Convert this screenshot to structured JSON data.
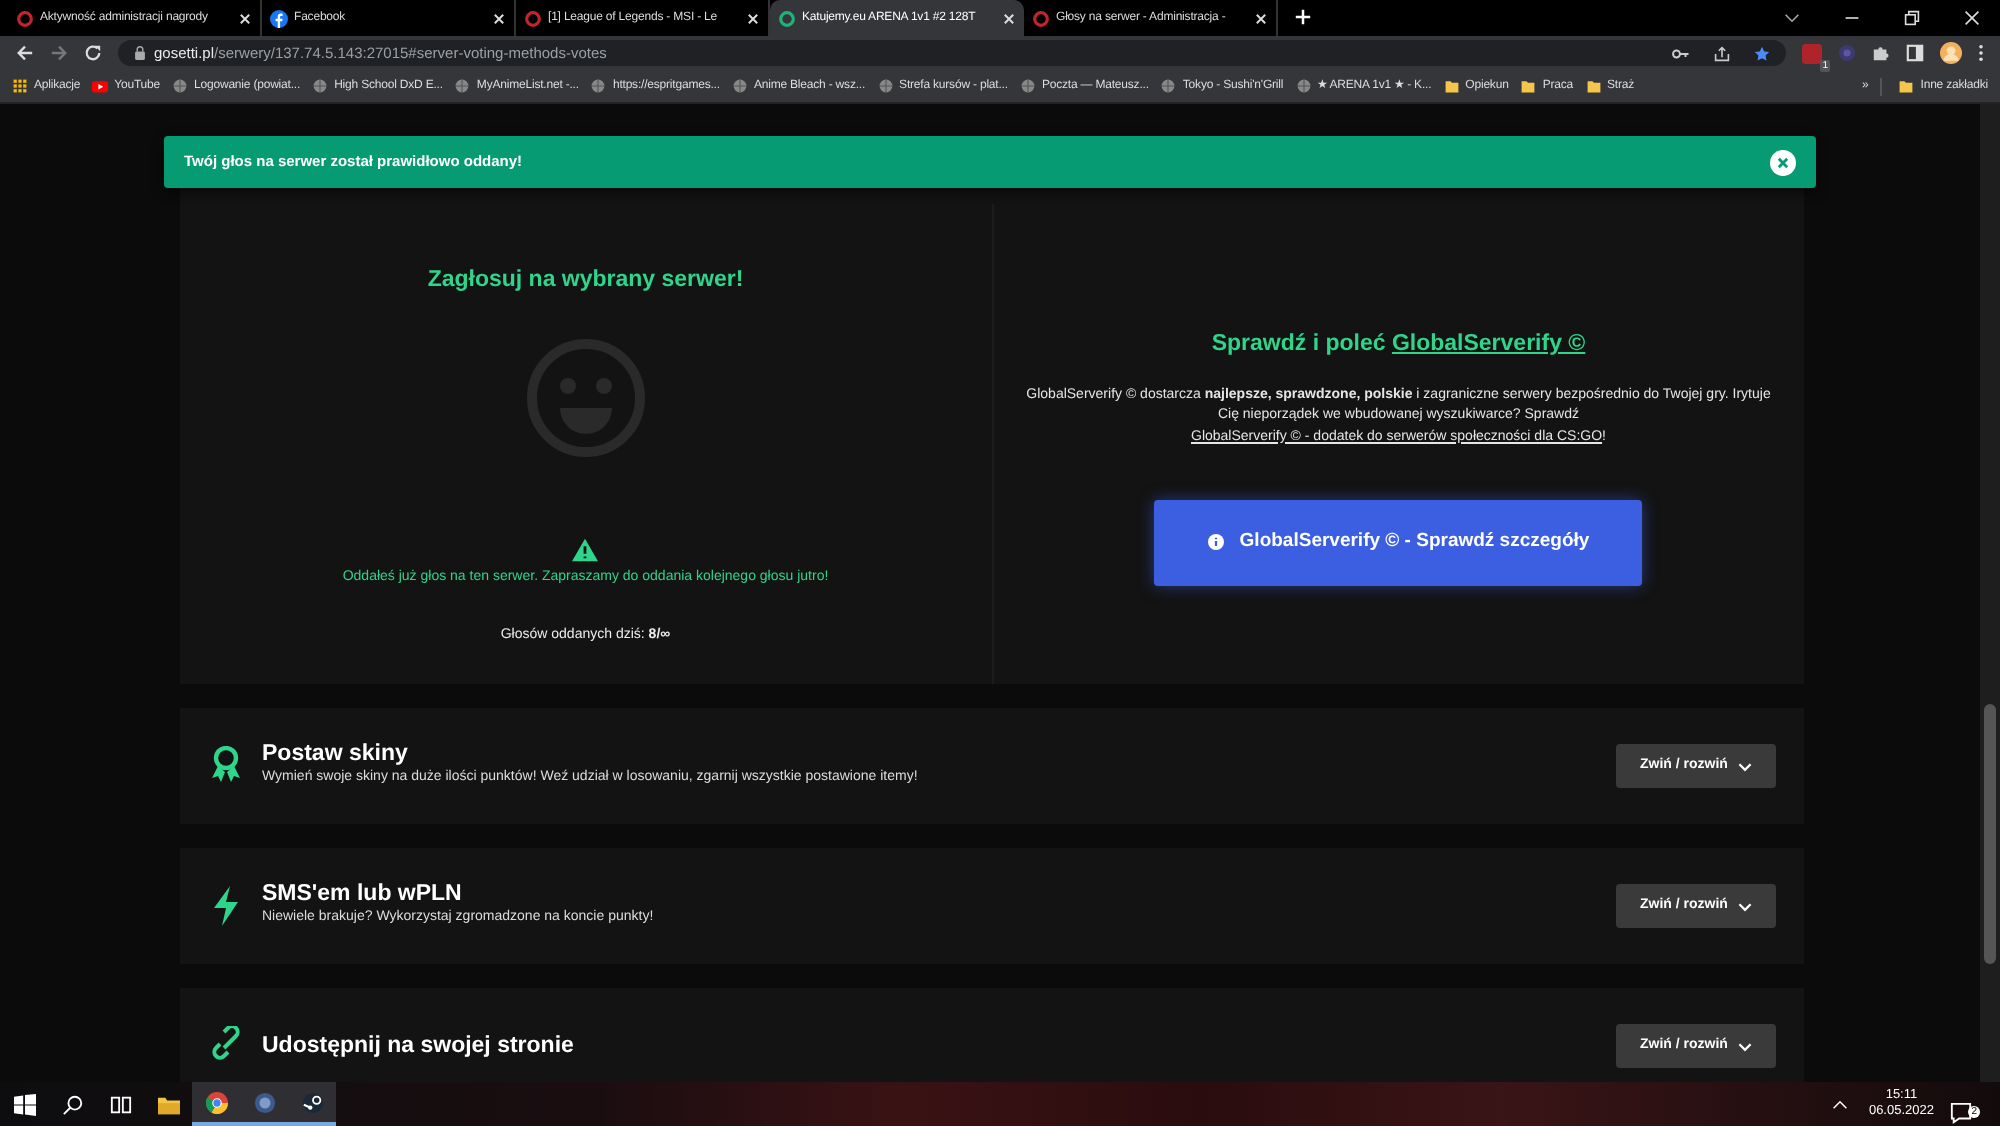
{
  "browser": {
    "tabs": [
      {
        "title": "Aktywność administracji nagrody",
        "kind": "ring",
        "selected": false
      },
      {
        "title": "Facebook",
        "kind": "social",
        "selected": false
      },
      {
        "title": "[1] League of Legends - MSI - Le",
        "kind": "ring",
        "selected": false
      },
      {
        "title": "Katujemy.eu ARENA 1v1 #2 128T",
        "kind": "ring",
        "selected": true
      },
      {
        "title": "Głosy na serwer - Administracja -",
        "kind": "ring",
        "selected": false
      }
    ],
    "address": {
      "domain": "gosetti.pl",
      "path": "/serwery/137.74.5.143:27015#server-voting-methods-votes"
    },
    "extension_badge": "1",
    "bookmarks": [
      {
        "label": "Aplikacje",
        "kind": "apps"
      },
      {
        "label": "YouTube",
        "kind": "video"
      },
      {
        "label": "Logowanie (powiat...",
        "kind": "site"
      },
      {
        "label": "High School DxD E...",
        "kind": "site"
      },
      {
        "label": "MyAnimeList.net -...",
        "kind": "site"
      },
      {
        "label": "https://espritgames...",
        "kind": "site"
      },
      {
        "label": "Anime Bleach - wsz...",
        "kind": "site"
      },
      {
        "label": "Strefa kursów - plat...",
        "kind": "site"
      },
      {
        "label": "Poczta — Mateusz...",
        "kind": "site"
      },
      {
        "label": "Tokyo - Sushi'n'Grill",
        "kind": "site"
      },
      {
        "label": "★ ARENA 1v1 ★ - K...",
        "kind": "site"
      },
      {
        "label": "Opiekun",
        "kind": "folder"
      },
      {
        "label": "Praca",
        "kind": "folder"
      },
      {
        "label": "Straż",
        "kind": "folder"
      }
    ],
    "more_bookmarks": "»",
    "other_bookmarks": "Inne zakładki"
  },
  "toast": {
    "text": "Twój głos na serwer został prawidłowo oddany!"
  },
  "vote": {
    "heading": "Zagłosuj na wybrany serwer!",
    "notice": "Oddałeś już głos na ten serwer. Zapraszamy do oddania kolejnego głosu jutro!",
    "votes": "Głosów oddanych dziś: **8/∞**"
  },
  "promo": {
    "heading": "Sprawdź i poleć",
    "heading_link": "GlobalServerify ©",
    "text": "GlobalServerify © dostarcza **najlepsze, sprawdzone, polskie** i zagraniczne serwery bezpośrednio do Twojej gry. Irytuje Cię nieporządek we wbudowanej wyszukiwarce? Sprawdź",
    "link": "GlobalServerify © - dodatek do serwerów społeczności dla CS:GO",
    "after": "!",
    "button": "GlobalServerify © - Sprawdź szczegóły"
  },
  "sections": [
    {
      "kind": "award",
      "title": "Postaw skiny",
      "description": "Wymień swoje skiny na duże ilości punktów! Weź udział w losowaniu, zgarnij wszystkie postawione itemy!",
      "button": "Zwiń / rozwiń"
    },
    {
      "kind": "bolt",
      "title": "SMS'em lub wPLN",
      "description": "Niewiele brakuje? Wykorzystaj zgromadzone na koncie punkty!",
      "button": "Zwiń / rozwiń"
    },
    {
      "kind": "link",
      "title": "Udostępnij na swojej stronie",
      "button": "Zwiń / rozwiń"
    }
  ],
  "taskbar": {
    "time": "15:11",
    "date": "06.05.2022",
    "notifications": "2"
  }
}
